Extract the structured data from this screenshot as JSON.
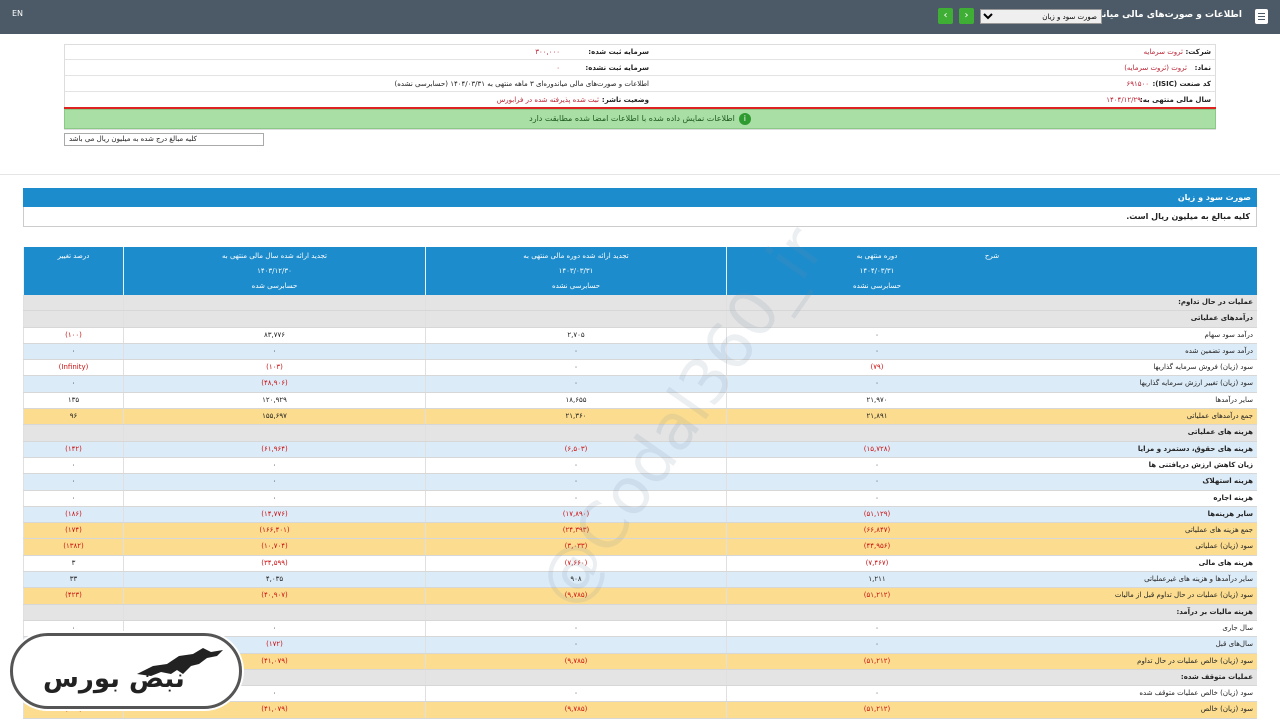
{
  "header": {
    "title": "اطلاعات و صورت‌های مالی میاندوره‌ای",
    "lang": "EN",
    "report_select": "صورت سود و زیان",
    "prev": "‹",
    "next": "›"
  },
  "info": {
    "company_label": "شرکت:",
    "company_value": "ثروت سرمایه",
    "symbol_label": "نماد:",
    "symbol_value": "ثروت (ثروت سرمایه)",
    "isic_label": "کد صنعت (ISIC):",
    "isic_value": "۶۹۱۵۰۰",
    "fiscal_label": "سال مالی منتهی به:",
    "fiscal_value": "۱۴۰۴/۱۲/۲۹",
    "capital_label": "سرمایه ثبت شده:",
    "capital_value": "۳۰۰,۰۰۰",
    "unreg_capital_label": "سرمایه ثبت نشده:",
    "unreg_capital_value": "۰",
    "desc_text": "اطلاعات و صورت‌های مالی میاندوره‌ای ۳ ماهه منتهی به ۱۴۰۴/۰۳/۳۱ (حسابرسی نشده)",
    "status_label": "وضعیت ناشر:",
    "status_value": "ثبت شده پذیرفته شده در فرابورس"
  },
  "notice": "اطلاعات نمایش داده شده با اطلاعات امضا شده مطابقت دارد",
  "unit_note": "کلیه مبالغ درج شده به میلیون ریال می باشد",
  "section_title": "صورت سود و زیان",
  "section_sub": "کلیه مبالغ به میلیون ریال است.",
  "columns": {
    "desc": "شرح",
    "p1_title": "دوره منتهی به",
    "p1_date": "۱۴۰۴/۰۳/۳۱",
    "p1_status": "حسابرسی نشده",
    "p2_title": "تجدید ارائه شده دوره مالی منتهی به",
    "p2_date": "۱۴۰۳/۰۳/۳۱",
    "p2_status": "حسابرسی نشده",
    "p3_title": "تجدید ارائه شده سال مالی منتهی به",
    "p3_date": "۱۴۰۳/۱۲/۳۰",
    "p3_status": "حسابرسی شده",
    "pct": "درصد تغییر"
  },
  "rows": [
    {
      "desc": "عملیات در حال تداوم:",
      "p1": "",
      "p2": "",
      "p3": "",
      "pct": "",
      "style": "gray"
    },
    {
      "desc": "درآمدهای عملیاتی",
      "p1": "",
      "p2": "",
      "p3": "",
      "pct": "",
      "style": "gray"
    },
    {
      "desc": "درآمد سود سهام",
      "p1": "۰",
      "p2": "۲,۷۰۵",
      "p3": "۸۳,۷۷۶",
      "pct": "(۱۰۰)",
      "style": "white"
    },
    {
      "desc": "درآمد سود تضمین شده",
      "p1": "۰",
      "p2": "۰",
      "p3": "۰",
      "pct": "۰",
      "style": "blue"
    },
    {
      "desc": "سود (زیان) فروش سرمایه گذاریها",
      "p1": "(۷۹)",
      "p2": "۰",
      "p3": "(۱۰۳)",
      "pct": "(Infinity)",
      "style": "white"
    },
    {
      "desc": "سود (زیان) تغییر ارزش سرمایه گذاریها",
      "p1": "۰",
      "p2": "۰",
      "p3": "(۴۸,۹۰۶)",
      "pct": "۰",
      "style": "blue"
    },
    {
      "desc": "سایر درآمدها",
      "p1": "۲۱,۹۷۰",
      "p2": "۱۸,۶۵۵",
      "p3": "۱۲۰,۹۲۹",
      "pct": "۱۳۵",
      "style": "white"
    },
    {
      "desc": "جمع درآمدهای عملیاتی",
      "p1": "۲۱,۸۹۱",
      "p2": "۲۱,۳۶۰",
      "p3": "۱۵۵,۶۹۷",
      "pct": "۹۶",
      "style": "yellow"
    },
    {
      "desc": "هزینه های عملیاتی",
      "p1": "",
      "p2": "",
      "p3": "",
      "pct": "",
      "style": "gray"
    },
    {
      "desc": "هزینه های حقوق، دستمزد و مزایا",
      "p1": "(۱۵,۷۲۸)",
      "p2": "(۶,۵۰۳)",
      "p3": "(۶۱,۹۶۴)",
      "pct": "(۱۴۲)",
      "style": "blue-bold"
    },
    {
      "desc": "زیان کاهش ارزش دریافتنی ها",
      "p1": "۰",
      "p2": "۰",
      "p3": "۰",
      "pct": "۰",
      "style": "white-bold"
    },
    {
      "desc": "هزینه استهلاک",
      "p1": "۰",
      "p2": "۰",
      "p3": "۰",
      "pct": "۰",
      "style": "blue-bold"
    },
    {
      "desc": "هزینه اجاره",
      "p1": "۰",
      "p2": "۰",
      "p3": "۰",
      "pct": "۰",
      "style": "white-bold"
    },
    {
      "desc": "سایر هزینه‌ها",
      "p1": "(۵۱,۱۲۹)",
      "p2": "(۱۷,۸۹۰)",
      "p3": "(۱۴,۷۷۶)",
      "pct": "(۱۸۶)",
      "style": "blue-bold"
    },
    {
      "desc": "جمع هزینه های عملیاتی",
      "p1": "(۶۶,۸۴۷)",
      "p2": "(۲۴,۳۹۳)",
      "p3": "(۱۶۶,۴۰۱)",
      "pct": "(۱۷۴)",
      "style": "yellow"
    },
    {
      "desc": "سود (زیان) عملیاتی",
      "p1": "(۴۴,۹۵۶)",
      "p2": "(۳,۰۳۳)",
      "p3": "(۱۰,۷۰۴)",
      "pct": "(۱۳۸۲)",
      "style": "yellow"
    },
    {
      "desc": "هزینه های مالی",
      "p1": "(۷,۴۶۷)",
      "p2": "(۷,۶۶۰)",
      "p3": "(۳۴,۵۹۹)",
      "pct": "۳",
      "style": "white-bold"
    },
    {
      "desc": "سایر درآمدها و هزینه های غیرعملیاتی",
      "p1": "۱,۲۱۱",
      "p2": "۹۰۸",
      "p3": "۴,۰۳۵",
      "pct": "۳۳",
      "style": "blue"
    },
    {
      "desc": "سود (زیان) عملیات در حال تداوم قبل از مالیات",
      "p1": "(۵۱,۲۱۲)",
      "p2": "(۹,۷۸۵)",
      "p3": "(۴۰,۹۰۷)",
      "pct": "(۴۲۳)",
      "style": "yellow"
    },
    {
      "desc": "هزینه مالیات بر درآمد:",
      "p1": "",
      "p2": "",
      "p3": "",
      "pct": "",
      "style": "gray"
    },
    {
      "desc": "سال جاری",
      "p1": "۰",
      "p2": "۰",
      "p3": "۰",
      "pct": "۰",
      "style": "white"
    },
    {
      "desc": "سال‌های قبل",
      "p1": "۰",
      "p2": "۰",
      "p3": "(۱۷۲)",
      "pct": "۰",
      "style": "blue"
    },
    {
      "desc": "سود (زیان) خالص عملیات در حال تداوم",
      "p1": "(۵۱,۲۱۲)",
      "p2": "(۹,۷۸۵)",
      "p3": "(۴۱,۰۷۹)",
      "pct": "",
      "style": "yellow"
    },
    {
      "desc": "عملیات متوقف شده:",
      "p1": "",
      "p2": "",
      "p3": "",
      "pct": "",
      "style": "gray"
    },
    {
      "desc": "سود (زیان) خالص عملیات متوقف شده",
      "p1": "۰",
      "p2": "۰",
      "p3": "۰",
      "pct": "",
      "style": "white"
    },
    {
      "desc": "سود (زیان) خالص",
      "p1": "(۵۱,۲۱۲)",
      "p2": "(۹,۷۸۵)",
      "p3": "(۴۱,۰۷۹)",
      "pct": "(۴۲۳)",
      "style": "yellow"
    }
  ],
  "logo_text": "نبض بورس",
  "watermark": "@Codal360_ir"
}
